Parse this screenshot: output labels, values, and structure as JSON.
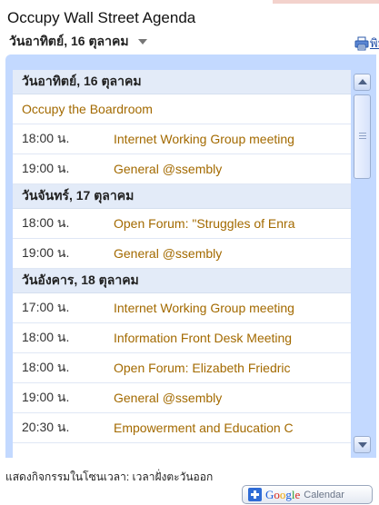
{
  "calendar": {
    "title": "Occupy Wall Street Agenda",
    "date_selector_label": "วันอาทิตย์, 16 ตุลาคม",
    "print_label": "พิมพ์"
  },
  "agenda": {
    "rows": [
      {
        "kind": "day",
        "label": "วันอาทิตย์, 16 ตุลาคม"
      },
      {
        "kind": "allday",
        "title": "Occupy the Boardroom"
      },
      {
        "kind": "event",
        "time": "18:00 น.",
        "title": "Internet Working Group meeting"
      },
      {
        "kind": "event",
        "time": "19:00 น.",
        "title": "General @ssembly"
      },
      {
        "kind": "day",
        "label": "วันจันทร์, 17 ตุลาคม"
      },
      {
        "kind": "event",
        "time": "18:00 น.",
        "title": "Open Forum: \"Struggles of Enra"
      },
      {
        "kind": "event",
        "time": "19:00 น.",
        "title": "General @ssembly"
      },
      {
        "kind": "day",
        "label": "วันอังคาร, 18 ตุลาคม"
      },
      {
        "kind": "event",
        "time": "17:00 น.",
        "title": "Internet Working Group meeting"
      },
      {
        "kind": "event",
        "time": "18:00 น.",
        "title": "Information Front Desk Meeting"
      },
      {
        "kind": "event",
        "time": "18:00 น.",
        "title": "Open Forum: Elizabeth Friedric"
      },
      {
        "kind": "event",
        "time": "19:00 น.",
        "title": "General @ssembly"
      },
      {
        "kind": "event",
        "time": "20:30 น.",
        "title": "Empowerment and Education C"
      }
    ]
  },
  "footer": {
    "timezone_note": "แสดงกิจกรรมในโซนเวลา: เวลาฝั่งตะวันออก",
    "google_letters": [
      "G",
      "o",
      "o",
      "g",
      "l",
      "e"
    ],
    "calendar_label": "Calendar"
  },
  "icons": {
    "print": "printer-icon",
    "scroll_up": "scroll-up-icon",
    "scroll_down": "scroll-down-icon",
    "add": "plus-icon",
    "dropdown": "chevron-down-icon"
  },
  "colors": {
    "frame": "#c3d9ff",
    "day_header_bg": "#e3ebf8",
    "event_link": "#a36a00",
    "print_link": "#1c4aa6"
  }
}
